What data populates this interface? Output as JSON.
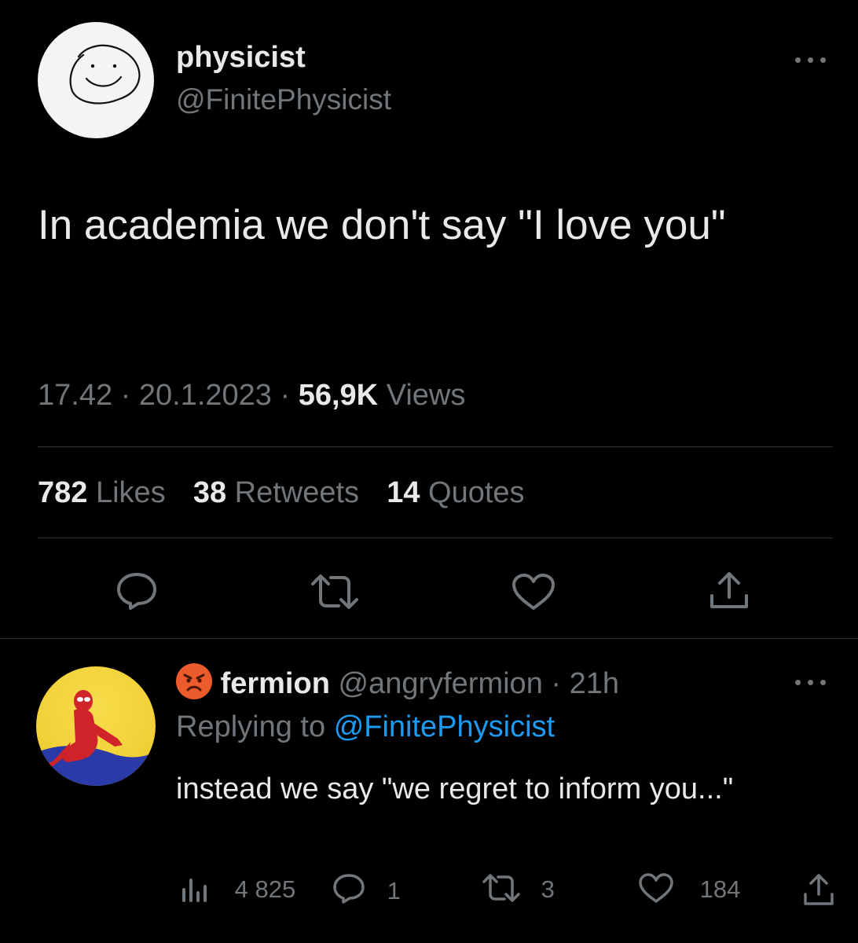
{
  "main_tweet": {
    "display_name": "physicist",
    "handle": "@FinitePhysicist",
    "text": "In academia we don't say \"I love you\"",
    "time": "17.42",
    "date": "20.1.2023",
    "views_count": "56,9K",
    "views_label": "Views",
    "likes_count": "782",
    "likes_label": "Likes",
    "retweets_count": "38",
    "retweets_label": "Retweets",
    "quotes_count": "14",
    "quotes_label": "Quotes"
  },
  "reply": {
    "emoji": "😡",
    "display_name": "fermion",
    "handle": "@angryfermion",
    "age": "21h",
    "replying_prefix": "Replying to",
    "replying_handle": "@FinitePhysicist",
    "text": "instead we say \"we regret to inform you...\"",
    "views": "4 825",
    "replies": "1",
    "retweets": "3",
    "likes": "184"
  },
  "colors": {
    "background": "#000000",
    "text": "#e7e9ea",
    "secondary": "#71767b",
    "link": "#1d9bf0",
    "divider": "#2f3336"
  },
  "icons": [
    "more-icon",
    "reply-icon",
    "retweet-icon",
    "like-icon",
    "share-icon",
    "views-icon",
    "angry-face-emoji"
  ]
}
